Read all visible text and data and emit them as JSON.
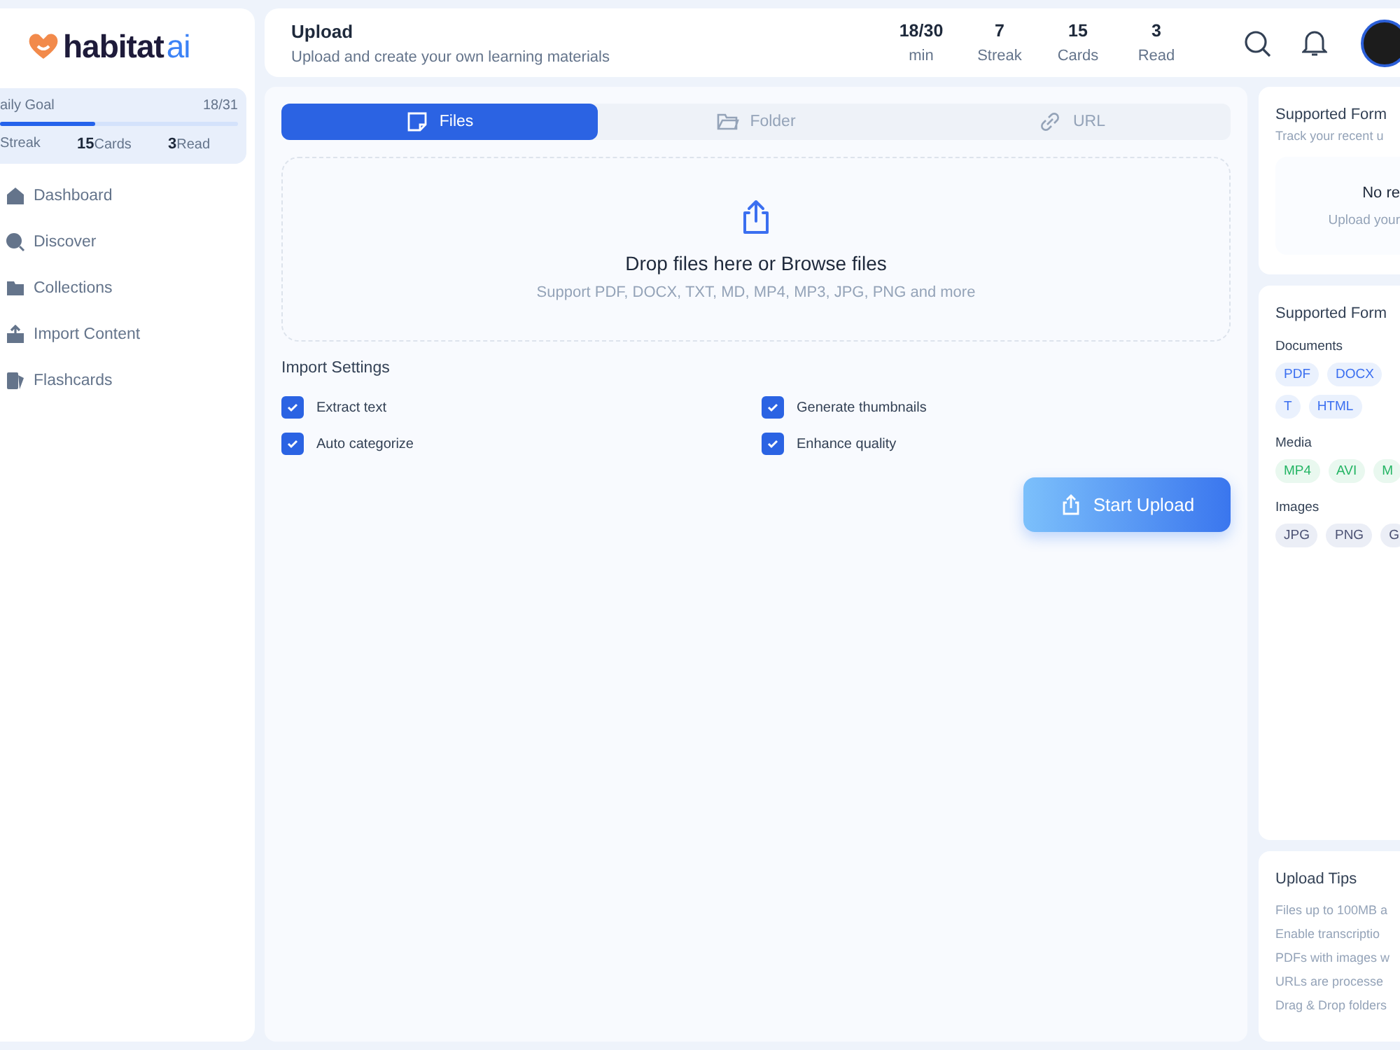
{
  "sidebar": {
    "logo": {
      "text": "habitat",
      "accent": "ai"
    },
    "goal": {
      "label": "aily Goal",
      "value": "18/31",
      "level": 0.4,
      "stats": [
        {
          "label": "Streak"
        },
        {
          "number": "15",
          "label": "Cards"
        },
        {
          "number": "3",
          "label": "Read"
        }
      ]
    },
    "items": [
      {
        "label": "Dashboard"
      },
      {
        "label": "Discover"
      },
      {
        "label": "Collections"
      },
      {
        "label": "Import Content"
      },
      {
        "label": "Flashcards"
      }
    ]
  },
  "header": {
    "title": "Upload",
    "subtitle": "Upload and create your own learning materials",
    "stats": [
      {
        "value": "18/30",
        "label": "min"
      },
      {
        "value": "7",
        "label": "Streak"
      },
      {
        "value": "15",
        "label": "Cards"
      },
      {
        "value": "3",
        "label": "Read"
      }
    ]
  },
  "tabs": [
    {
      "label": "Files",
      "selected": true
    },
    {
      "label": "Folder",
      "selected": false
    },
    {
      "label": "URL",
      "selected": false
    }
  ],
  "dropzone": {
    "title": "Drop files here or Browse files",
    "hint": "Support PDF, DOCX, TXT, MD, MP4, MP3, JPG, PNG and more"
  },
  "import_settings": {
    "title": "Import Settings",
    "options": [
      {
        "label": "Extract text",
        "checked": true
      },
      {
        "label": "Generate thumbnails",
        "checked": true
      },
      {
        "label": "Auto categorize",
        "checked": true
      },
      {
        "label": "Enhance quality",
        "checked": true
      }
    ]
  },
  "start_button": "Start Upload",
  "recent": {
    "title": "Supported Form",
    "subtitle": "Track your recent u",
    "empty_title": "No re",
    "empty_hint": "Upload your"
  },
  "formats": {
    "title": "Supported Form",
    "groups": [
      {
        "name": "Documents",
        "kind": "doc",
        "chips": [
          "PDF",
          "DOCX",
          "T",
          "HTML"
        ]
      },
      {
        "name": "Media",
        "kind": "media",
        "chips": [
          "MP4",
          "AVI",
          "M"
        ]
      },
      {
        "name": "Images",
        "kind": "image",
        "chips": [
          "JPG",
          "PNG",
          "G"
        ]
      }
    ]
  },
  "tips": {
    "title": "Upload Tips",
    "items": [
      "Files up to 100MB a",
      "Enable transcriptio",
      "PDFs with images w",
      "URLs are processe",
      "Drag & Drop folders"
    ]
  }
}
